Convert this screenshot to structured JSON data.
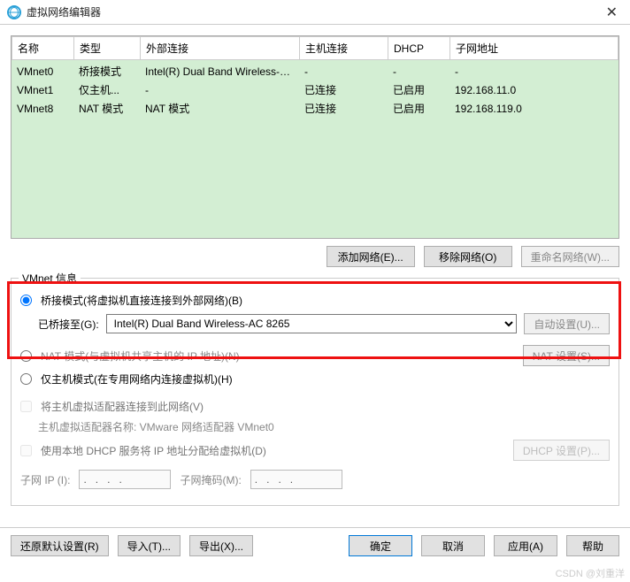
{
  "window": {
    "title": "虚拟网络编辑器",
    "close_glyph": "✕"
  },
  "table": {
    "headers": {
      "name": "名称",
      "type": "类型",
      "extconn": "外部连接",
      "hostconn": "主机连接",
      "dhcp": "DHCP",
      "subnet": "子网地址"
    },
    "rows": [
      {
        "name": "VMnet0",
        "type": "桥接模式",
        "extconn": "Intel(R) Dual Band Wireless-A...",
        "hostconn": "-",
        "dhcp": "-",
        "subnet": "-"
      },
      {
        "name": "VMnet1",
        "type": "仅主机...",
        "extconn": "-",
        "hostconn": "已连接",
        "dhcp": "已启用",
        "subnet": "192.168.11.0"
      },
      {
        "name": "VMnet8",
        "type": "NAT 模式",
        "extconn": "NAT 模式",
        "hostconn": "已连接",
        "dhcp": "已启用",
        "subnet": "192.168.119.0"
      }
    ]
  },
  "buttons": {
    "add_network": "添加网络(E)...",
    "remove_network": "移除网络(O)",
    "rename_network": "重命名网络(W)..."
  },
  "vmnet_info": {
    "title": "VMnet 信息",
    "bridge_mode": "桥接模式(将虚拟机直接连接到外部网络)(B)",
    "bridged_to": "已桥接至(G):",
    "bridged_adapter_selected": "Intel(R) Dual Band Wireless-AC 8265",
    "auto_settings": "自动设置(U)...",
    "nat_mode": "NAT 模式(与虚拟机共享主机的 IP 地址)(N)",
    "nat_settings": "NAT 设置(S)...",
    "hostonly_mode": "仅主机模式(在专用网络内连接虚拟机)(H)",
    "connect_host_adapter": "将主机虚拟适配器连接到此网络(V)",
    "host_adapter_name_label": "主机虚拟适配器名称: VMware 网络适配器 VMnet0",
    "use_local_dhcp": "使用本地 DHCP 服务将 IP 地址分配给虚拟机(D)",
    "dhcp_settings": "DHCP 设置(P)...",
    "subnet_ip_label": "子网 IP (I):",
    "subnet_ip_value": ".   .   .   .",
    "subnet_mask_label": "子网掩码(M):",
    "subnet_mask_value": ".   .   .   ."
  },
  "footer": {
    "restore_defaults": "还原默认设置(R)",
    "import": "导入(T)...",
    "export": "导出(X)...",
    "ok": "确定",
    "cancel": "取消",
    "apply": "应用(A)",
    "help": "帮助"
  },
  "watermark": "CSDN @刘重洋"
}
